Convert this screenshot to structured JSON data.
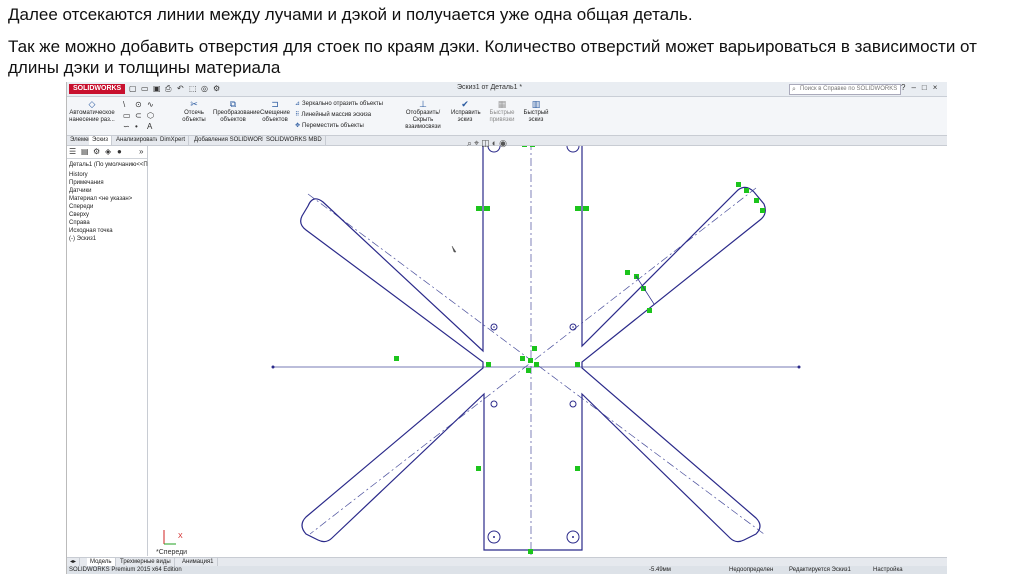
{
  "caption": {
    "line1": "Далее отсекаются линии между лучами и дэкой и получается уже одна общая деталь.",
    "line2": "Так же можно добавить отверстия для стоек по краям дэки. Количество отверстий может варьироваться в зависимости от длины дэки и толщины материала"
  },
  "app": {
    "logo": "SOLIDWORKS",
    "title": "Эскиз1 от Деталь1 *",
    "search_placeholder": "Поиск в Справке по SOLIDWORKS"
  },
  "ribbon": {
    "smart_dim": "Автоматическое нанесение раз...",
    "trim": "Отсечь объекты",
    "convert": "Преобразование объектов",
    "offset": "Смещение объектов",
    "mirror": "Зеркально отразить объекты",
    "linear_pattern": "Линейный массив эскиза",
    "move": "Переместить объекты",
    "display_relations": "Отобразить/Скрыть взаимосвязи",
    "repair": "Исправить эскиз",
    "quick_snaps": "Быстрые привязки",
    "rapid_sketch": "Быстрый эскиз"
  },
  "tabs": [
    "Элементы",
    "Эскиз",
    "Анализировать",
    "DimXpert",
    "Добавления SOLIDWORKS",
    "SOLIDWORKS MBD"
  ],
  "tree": {
    "root": "Деталь1  (По умолчанию<<По",
    "items": [
      "History",
      "Примечания",
      "Датчики",
      "Материал <не указан>",
      "Спереди",
      "Сверху",
      "Справа",
      "Исходная точка",
      "(-) Эскиз1"
    ]
  },
  "canvas": {
    "triad_label": "*Спереди",
    "triad_axis": "X"
  },
  "bottom_tabs": [
    "Модель",
    "Трехмерные виды",
    "Анимация1"
  ],
  "status": {
    "edition": "SOLIDWORKS Premium 2015 x64 Edition",
    "coord": "-5.49мм",
    "state": "Недоопределен",
    "editing": "Редактируется Эскиз1",
    "custom": "Настройка"
  },
  "colors": {
    "sketch_line": "#2b2a8a",
    "relation_marker": "#1cc41c",
    "construction_line": "#4a4f9c"
  }
}
